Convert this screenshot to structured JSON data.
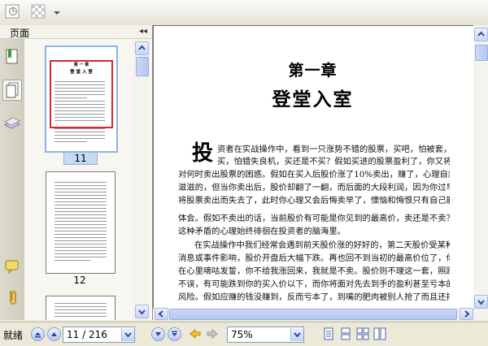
{
  "toolbar": {
    "items": [
      "pointer-tool",
      "thumbnail-tool",
      "dropdown"
    ]
  },
  "sidebar": {
    "title": "页面",
    "collapse_glyph": "◂◂"
  },
  "thumbnails": [
    {
      "label": "11",
      "heading1": "第 一 章",
      "heading2": "登 堂 入 室",
      "selected": true
    },
    {
      "label": "12",
      "selected": false
    }
  ],
  "document": {
    "chapter": "第一章",
    "title": "登堂入室",
    "drop_cap": "投",
    "lines": [
      "资者在实战操作中，看到一只涨势不错的股票，买吧，怕被套，不",
      "买，怕错失良机，买还是不买？假如买进的股票盈利了，你又将面",
      "对何时卖出股票的困惑。假如在买入后股价涨了10%卖出，赚了，心理自然喜",
      "滋滋的，但当你卖出后，股价却翻了一翻，而后面的大段利润，因为你过早",
      "将股票卖出而失去了，此时你心理又会后悔卖早了，懊恼和悔恨只有自己能",
      "体会。假如不卖出的话，当前股价有可能是你见到的最高价，卖还是不卖？",
      "这种矛盾的心理始终徘徊在投资者的脑海里。",
      "在实战操作中我们经常会遇到前天股价涨的好好的，第二天股价受某种",
      "消息或事件影响，股价开盘后大幅下跌。再也回不到当初的最高价位了，你",
      "在心里嘀咕发誓，你不给我涨回来，我就是不卖。股价则不理这一套，照跌",
      "不误，有可能跌到你的买入价以下，而你将面对先去到手的盈利甚至亏本的",
      "风险。假如应赚的钱没赚到，反而亏本了，到嘴的肥肉被别人抢了而且还拌"
    ]
  },
  "statusbar": {
    "status": "就绪",
    "page_current": "11 / 216",
    "zoom": "75%"
  }
}
